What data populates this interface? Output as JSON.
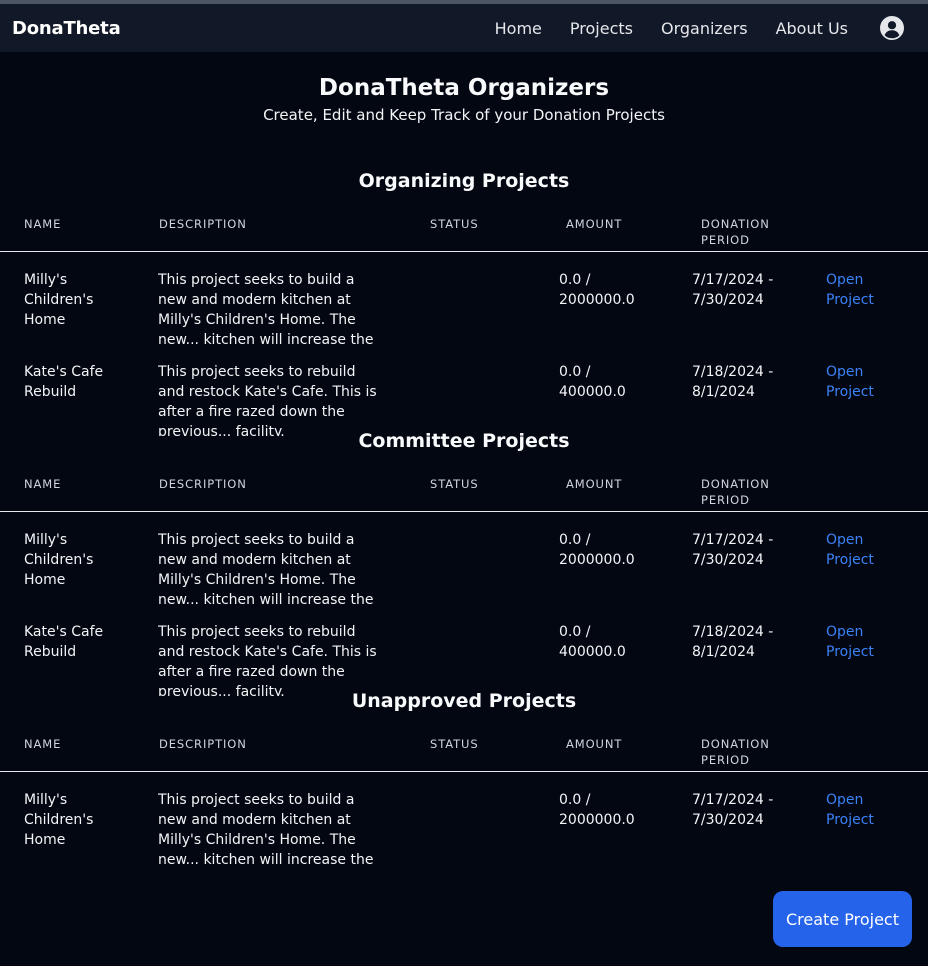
{
  "app": {
    "brand": "DonaTheta"
  },
  "nav": {
    "home": "Home",
    "projects": "Projects",
    "organizers": "Organizers",
    "about": "About Us",
    "profile_icon": "user-circle-icon"
  },
  "page": {
    "title": "DonaTheta Organizers",
    "subtitle": "Create, Edit and Keep Track of your Donation Projects"
  },
  "columns": {
    "name": "NAME",
    "description": "DESCRIPTION",
    "status": "STATUS",
    "amount": "AMOUNT",
    "period_line1": "DONATION",
    "period_line2": "PERIOD"
  },
  "sections": [
    {
      "title": "Organizing Projects",
      "rows": [
        {
          "name": "Milly's Children's Home",
          "description": "This project seeks to build a new and modern kitchen at Milly's Children's Home. The new... kitchen will increase the capacity",
          "status": "",
          "amount": "0.0 / 2000000.0",
          "period": "7/17/2024 - 7/30/2024",
          "link": "Open Project"
        },
        {
          "name": "Kate's Cafe Rebuild",
          "description": "This project seeks to rebuild and restock Kate's Cafe. This is after a fire razed down the previous... facility.",
          "status": "",
          "amount": "0.0 / 400000.0",
          "period": "7/18/2024 - 8/1/2024",
          "link": "Open Project"
        }
      ]
    },
    {
      "title": "Committee Projects",
      "rows": [
        {
          "name": "Milly's Children's Home",
          "description": "This project seeks to build a new and modern kitchen at Milly's Children's Home. The new... kitchen will increase the capacity",
          "status": "",
          "amount": "0.0 / 2000000.0",
          "period": "7/17/2024 - 7/30/2024",
          "link": "Open Project"
        },
        {
          "name": "Kate's Cafe Rebuild",
          "description": "This project seeks to rebuild and restock Kate's Cafe. This is after a fire razed down the previous... facility.",
          "status": "",
          "amount": "0.0 / 400000.0",
          "period": "7/18/2024 - 8/1/2024",
          "link": "Open Project"
        }
      ]
    },
    {
      "title": "Unapproved Projects",
      "rows": [
        {
          "name": "Milly's Children's Home",
          "description": "This project seeks to build a new and modern kitchen at Milly's Children's Home. The new... kitchen will increase the capacity",
          "status": "",
          "amount": "0.0 / 2000000.0",
          "period": "7/17/2024 - 7/30/2024",
          "link": "Open Project"
        }
      ]
    }
  ],
  "actions": {
    "create_project": "Create Project"
  },
  "colors": {
    "background": "#030712",
    "navbar": "#111827",
    "link": "#3b82f6",
    "button": "#2563eb"
  }
}
